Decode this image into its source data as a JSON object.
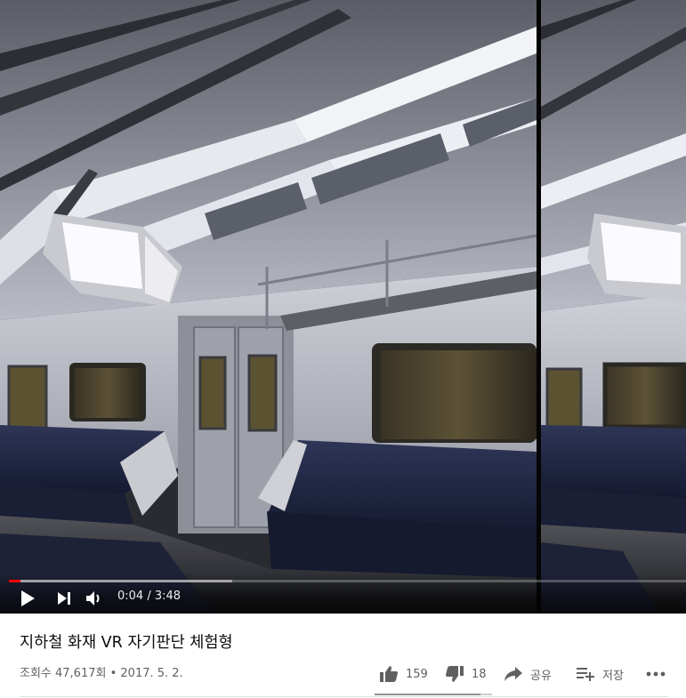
{
  "player": {
    "time_current": "0:04",
    "time_separator": " / ",
    "time_total": "3:48",
    "played_fraction": 0.0175,
    "buffered_fraction": 0.33,
    "icons": {
      "play": "play-icon",
      "next": "next-icon",
      "volume": "volume-icon"
    }
  },
  "video": {
    "title": "지하철 화재 VR 자기판단 체험형",
    "views": "조회수 47,617회",
    "separator": " • ",
    "date": "2017. 5. 2."
  },
  "actions": {
    "like_count": "159",
    "dislike_count": "18",
    "share_label": "공유",
    "save_label": "저장",
    "like_ratio": 0.898,
    "icons": {
      "like": "thumbs-up-icon",
      "dislike": "thumbs-down-icon",
      "share": "share-icon",
      "save": "playlist-add-icon",
      "more": "more-icon"
    }
  },
  "colors": {
    "progress_played": "#ff0000",
    "text_primary": "#0d0d0d",
    "text_secondary": "#606060",
    "seat_blue": "#2b3252"
  }
}
